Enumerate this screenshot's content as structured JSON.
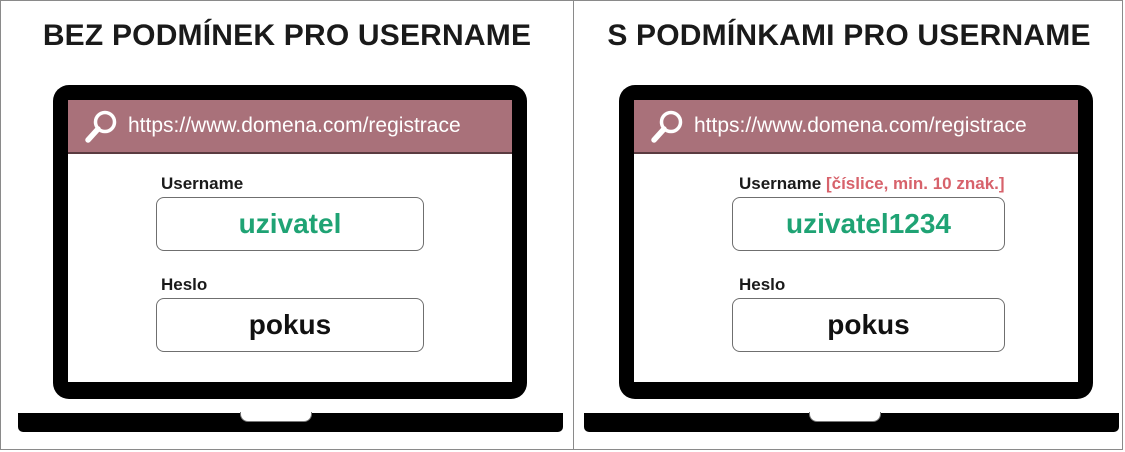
{
  "panels": [
    {
      "title": "BEZ PODMÍNEK PRO USERNAME",
      "url": "https://www.domena.com/registrace",
      "username_label": "Username",
      "username_hint": "",
      "username_value": "uzivatel",
      "password_label": "Heslo",
      "password_value": "pokus"
    },
    {
      "title": "S PODMÍNKAMI PRO USERNAME",
      "url": "https://www.domena.com/registrace",
      "username_label": "Username",
      "username_hint": "[číslice, min. 10 znak.]",
      "username_value": "uzivatel1234",
      "password_label": "Heslo",
      "password_value": "pokus"
    }
  ],
  "colors": {
    "url_bar": "#a9717a",
    "username_value": "#1fa374",
    "hint": "#d7626b"
  },
  "icons": [
    "search-icon",
    "search-icon"
  ]
}
